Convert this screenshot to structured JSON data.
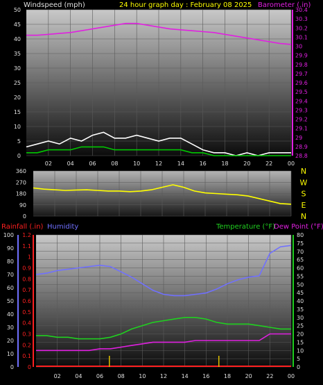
{
  "colors": {
    "background": "#000000",
    "title": "#ffff00",
    "windspeed": "#ffffff",
    "gust": "#00c800",
    "barometer": "#e020e0",
    "direction": "#ffff00",
    "rain": "#ff2020",
    "humidity": "#7070ff",
    "temperature": "#20d020",
    "dewpoint": "#e020e0",
    "rain_bar": "#e0c000"
  },
  "chart_data": [
    {
      "type": "line",
      "title": "24 hour graph day : February 08 2025",
      "ylabel": "Windspeed (mph)",
      "y2label": "Barometer (.in)",
      "ylim": [
        0,
        50
      ],
      "y2lim": [
        28.8,
        30.4
      ],
      "y_ticks": [
        "0",
        "5",
        "10",
        "15",
        "20",
        "25",
        "30",
        "35",
        "40",
        "45",
        "50"
      ],
      "y2_ticks": [
        "28.8",
        "28.9",
        "29",
        "29.1",
        "29.2",
        "29.3",
        "29.4",
        "29.5",
        "29.6",
        "29.7",
        "29.8",
        "29.9",
        "30",
        "30.1",
        "30.2",
        "30.3",
        "30.4"
      ],
      "x_ticks": [
        "02",
        "04",
        "06",
        "08",
        "10",
        "12",
        "14",
        "16",
        "18",
        "20",
        "22",
        "00"
      ],
      "grid": true,
      "series": [
        {
          "axis": "y2",
          "x": [
            0,
            1,
            2,
            3,
            4,
            5,
            6,
            7,
            8,
            9,
            10,
            11,
            12,
            13,
            14,
            15,
            16,
            17,
            18,
            19,
            20,
            21,
            22,
            23,
            24
          ],
          "values": [
            30.12,
            30.12,
            30.13,
            30.14,
            30.15,
            30.17,
            30.19,
            30.21,
            30.23,
            30.25,
            30.25,
            30.23,
            30.21,
            30.19,
            30.18,
            30.17,
            30.16,
            30.15,
            30.13,
            30.11,
            30.09,
            30.07,
            30.05,
            30.03,
            30.02
          ]
        },
        {
          "axis": "y",
          "x": [
            0,
            1,
            2,
            3,
            4,
            5,
            6,
            7,
            8,
            9,
            10,
            11,
            12,
            13,
            14,
            15,
            16,
            17,
            18,
            19,
            20,
            21,
            22,
            23,
            24
          ],
          "values": [
            3,
            4,
            5,
            4,
            6,
            5,
            7,
            8,
            6,
            6,
            7,
            6,
            5,
            6,
            6,
            4,
            2,
            1,
            1,
            0,
            1,
            0,
            1,
            1,
            1
          ]
        },
        {
          "axis": "y",
          "x": [
            0,
            1,
            2,
            3,
            4,
            5,
            6,
            7,
            8,
            9,
            10,
            11,
            12,
            13,
            14,
            15,
            16,
            17,
            18,
            19,
            20,
            21,
            22,
            23,
            24
          ],
          "values": [
            1,
            1,
            2,
            2,
            2,
            3,
            3,
            3,
            2,
            2,
            2,
            2,
            2,
            2,
            2,
            1,
            1,
            0,
            0,
            0,
            0,
            0,
            0,
            0,
            0
          ]
        }
      ]
    },
    {
      "type": "line",
      "ylim": [
        0,
        360
      ],
      "y_ticks": [
        "0",
        "90",
        "180",
        "270",
        "360"
      ],
      "compass": [
        "N",
        "W",
        "S",
        "E",
        "N"
      ],
      "x_ticks": [
        "02",
        "04",
        "06",
        "08",
        "10",
        "12",
        "14",
        "16",
        "18",
        "20",
        "22",
        "00"
      ],
      "series": [
        {
          "x": [
            0,
            1,
            2,
            3,
            4,
            5,
            6,
            7,
            8,
            9,
            10,
            11,
            12,
            13,
            14,
            15,
            16,
            17,
            18,
            19,
            20,
            21,
            22,
            23,
            24
          ],
          "values": [
            225,
            215,
            210,
            205,
            208,
            210,
            205,
            200,
            200,
            195,
            200,
            210,
            230,
            250,
            230,
            200,
            185,
            180,
            175,
            170,
            160,
            140,
            120,
            100,
            95
          ]
        }
      ]
    },
    {
      "type": "line",
      "ylabel": "Rainfall (.in)",
      "ylabel2": "Humidity",
      "y2label": "Temperature (°F)",
      "y2label2": "Dew Point (°F)",
      "humidity_lim": [
        0,
        100
      ],
      "rain_lim": [
        0,
        1.2
      ],
      "temp_lim": [
        0,
        80
      ],
      "humidity_ticks": [
        "0",
        "10",
        "20",
        "30",
        "40",
        "50",
        "60",
        "70",
        "80",
        "90",
        "100"
      ],
      "rain_ticks": [
        "0",
        "0.1",
        "0.2",
        "0.3",
        "0.4",
        "0.5",
        "0.6",
        "0.7",
        "0.8",
        "0.9",
        "1",
        "1.1",
        "1.2"
      ],
      "temp_ticks": [
        "0",
        "5",
        "10",
        "15",
        "20",
        "25",
        "30",
        "35",
        "40",
        "45",
        "50",
        "55",
        "60",
        "65",
        "70",
        "75",
        "80"
      ],
      "x_ticks": [
        "02",
        "04",
        "06",
        "08",
        "10",
        "12",
        "14",
        "16",
        "18",
        "20",
        "22",
        "00"
      ],
      "series": [
        {
          "name": "Humidity",
          "axis": "humidity",
          "x": [
            0,
            1,
            2,
            3,
            4,
            5,
            6,
            7,
            8,
            9,
            10,
            11,
            12,
            13,
            14,
            15,
            16,
            17,
            18,
            19,
            20,
            21,
            22,
            23,
            24
          ],
          "values": [
            70,
            71,
            73,
            74,
            75,
            76,
            77,
            76,
            72,
            68,
            63,
            58,
            55,
            54,
            54,
            55,
            56,
            59,
            63,
            66,
            68,
            69,
            86,
            91,
            92
          ]
        },
        {
          "name": "Temperature",
          "axis": "temp",
          "x": [
            0,
            1,
            2,
            3,
            4,
            5,
            6,
            7,
            8,
            9,
            10,
            11,
            12,
            13,
            14,
            15,
            16,
            17,
            18,
            19,
            20,
            21,
            22,
            23,
            24
          ],
          "values": [
            19,
            19,
            18,
            18,
            17,
            17,
            17,
            18,
            20,
            23,
            25,
            27,
            28,
            29,
            30,
            30,
            29,
            27,
            26,
            26,
            26,
            25,
            24,
            23,
            23
          ]
        },
        {
          "name": "Dew Point",
          "axis": "temp",
          "x": [
            0,
            1,
            2,
            3,
            4,
            5,
            6,
            7,
            8,
            9,
            10,
            11,
            12,
            13,
            14,
            15,
            16,
            17,
            18,
            19,
            20,
            21,
            22,
            23,
            24
          ],
          "values": [
            10,
            10,
            10,
            10,
            10,
            10,
            11,
            11,
            12,
            13,
            14,
            15,
            15,
            15,
            15,
            16,
            16,
            16,
            16,
            16,
            16,
            16,
            20,
            20,
            20
          ]
        },
        {
          "name": "Rainfall",
          "axis": "rain",
          "x": [
            0,
            24
          ],
          "values": [
            0,
            0
          ]
        }
      ],
      "rain_events_hour": [
        6.9,
        17.2
      ]
    }
  ]
}
